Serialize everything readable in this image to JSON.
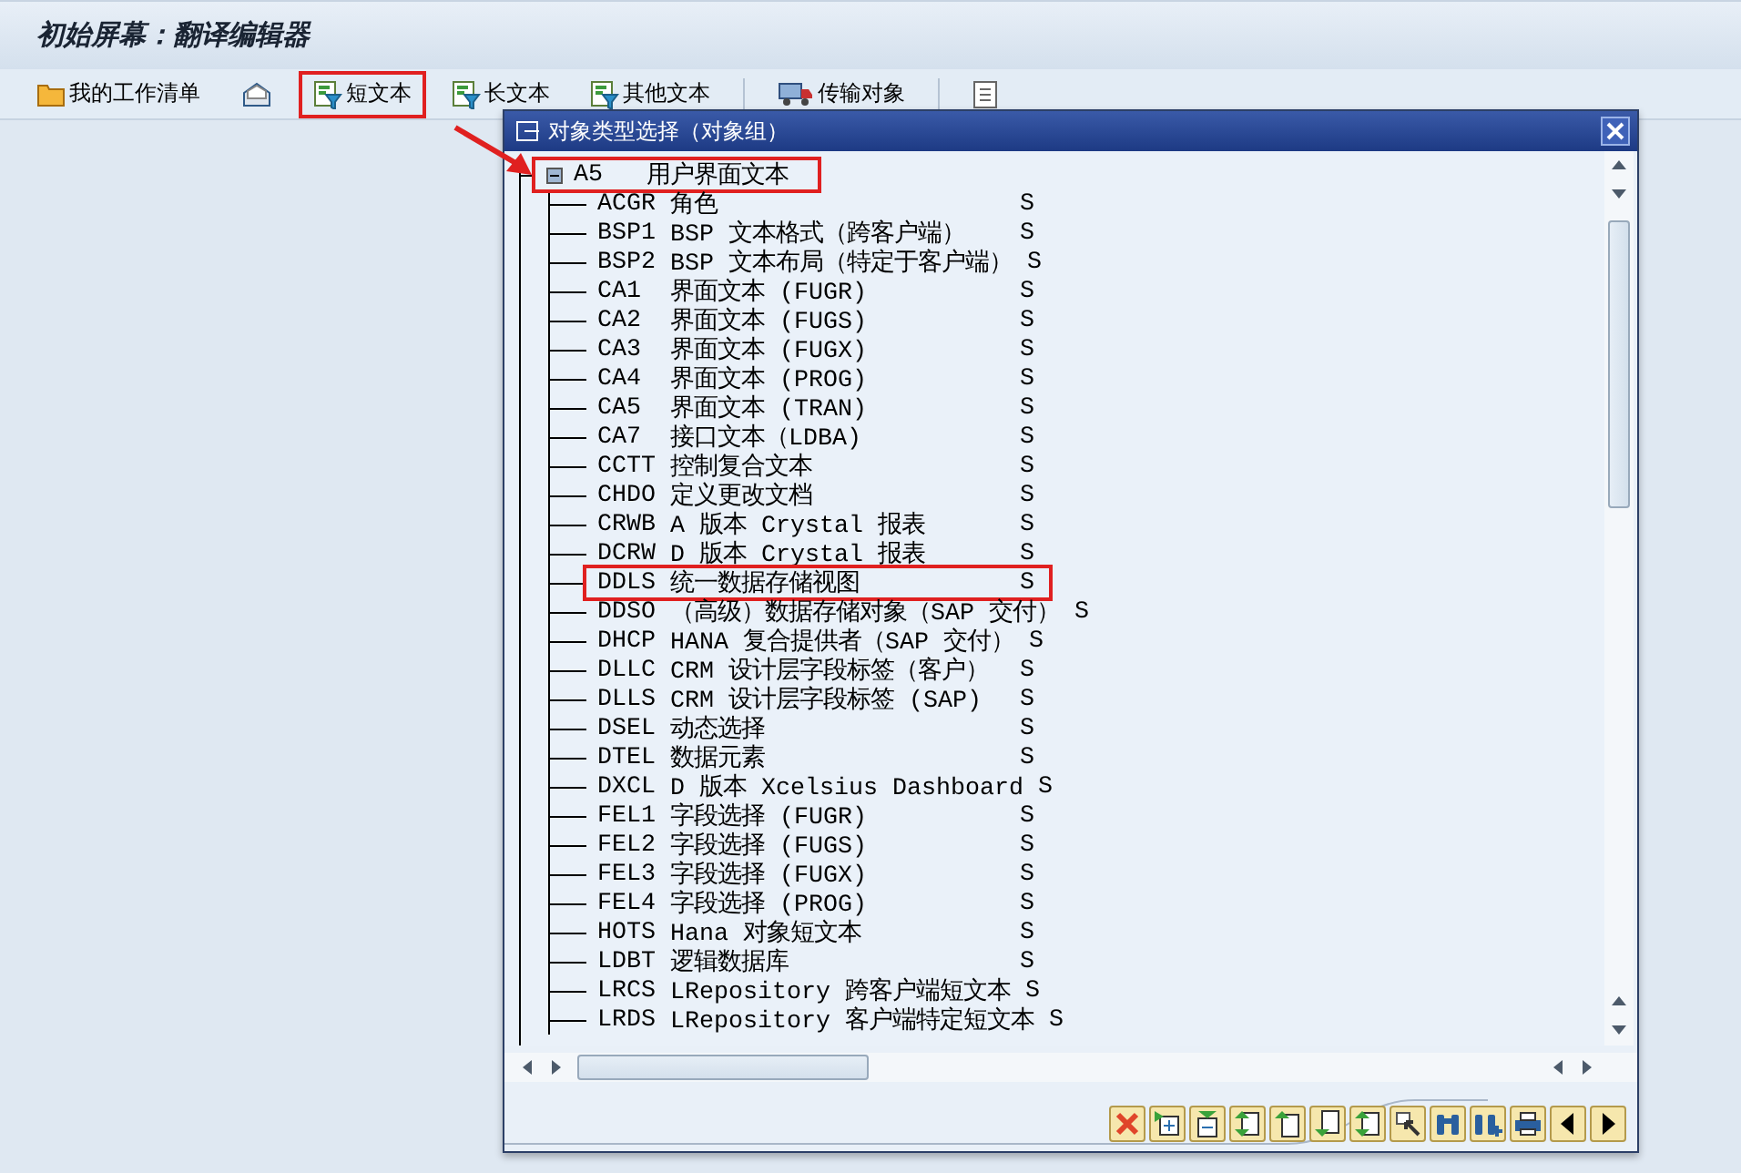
{
  "page": {
    "title": "初始屏幕：翻译编辑器"
  },
  "toolbar": [
    {
      "label": "我的工作清单",
      "highlighted": false
    },
    {
      "highlighted": false
    },
    {
      "label": "短文本",
      "highlighted": true
    },
    {
      "label": "长文本",
      "highlighted": false
    },
    {
      "label": "其他文本",
      "highlighted": false
    },
    {
      "label": "传输对象",
      "highlighted": false
    },
    {
      "highlighted": false
    }
  ],
  "dialog": {
    "title": "对象类型选择（对象组）",
    "tree": {
      "code": "A5",
      "text": "用户界面文本",
      "expanded": true,
      "highlighted": true,
      "children": [
        {
          "code": "ACGR",
          "text": "角色",
          "flag": "S",
          "highlighted": false
        },
        {
          "code": "BSP1",
          "text": "BSP 文本格式（跨客户端）",
          "flag": "S",
          "highlighted": false
        },
        {
          "code": "BSP2",
          "text": "BSP 文本布局（特定于客户端）",
          "flag": "S",
          "highlighted": false
        },
        {
          "code": "CA1",
          "text": "界面文本 (FUGR)",
          "flag": "S",
          "highlighted": false
        },
        {
          "code": "CA2",
          "text": "界面文本 (FUGS)",
          "flag": "S",
          "highlighted": false
        },
        {
          "code": "CA3",
          "text": "界面文本 (FUGX)",
          "flag": "S",
          "highlighted": false
        },
        {
          "code": "CA4",
          "text": "界面文本 (PROG)",
          "flag": "S",
          "highlighted": false
        },
        {
          "code": "CA5",
          "text": "界面文本 (TRAN)",
          "flag": "S",
          "highlighted": false
        },
        {
          "code": "CA7",
          "text": "接口文本（LDBA)",
          "flag": "S",
          "highlighted": false
        },
        {
          "code": "CCTT",
          "text": "控制复合文本",
          "flag": "S",
          "highlighted": false
        },
        {
          "code": "CHDO",
          "text": "定义更改文档",
          "flag": "S",
          "highlighted": false
        },
        {
          "code": "CRWB",
          "text": "A 版本 Crystal 报表",
          "flag": "S",
          "highlighted": false
        },
        {
          "code": "DCRW",
          "text": "D 版本 Crystal 报表",
          "flag": "S",
          "highlighted": false
        },
        {
          "code": "DDLS",
          "text": "统一数据存储视图",
          "flag": "S",
          "highlighted": true
        },
        {
          "code": "DDSO",
          "text": "（高级）数据存储对象（SAP 交付）",
          "flag": "S",
          "highlighted": false
        },
        {
          "code": "DHCP",
          "text": "HANA 复合提供者（SAP 交付）",
          "flag": "S",
          "highlighted": false
        },
        {
          "code": "DLLC",
          "text": "CRM 设计层字段标签（客户）",
          "flag": "S",
          "highlighted": false
        },
        {
          "code": "DLLS",
          "text": "CRM 设计层字段标签 (SAP)",
          "flag": "S",
          "highlighted": false
        },
        {
          "code": "DSEL",
          "text": "动态选择",
          "flag": "S",
          "highlighted": false
        },
        {
          "code": "DTEL",
          "text": "数据元素",
          "flag": "S",
          "highlighted": false
        },
        {
          "code": "DXCL",
          "text": "D 版本 Xcelsius Dashboard",
          "flag": "S",
          "highlighted": false
        },
        {
          "code": "FEL1",
          "text": "字段选择 (FUGR)",
          "flag": "S",
          "highlighted": false
        },
        {
          "code": "FEL2",
          "text": "字段选择 (FUGS)",
          "flag": "S",
          "highlighted": false
        },
        {
          "code": "FEL3",
          "text": "字段选择 (FUGX)",
          "flag": "S",
          "highlighted": false
        },
        {
          "code": "FEL4",
          "text": "字段选择 (PROG)",
          "flag": "S",
          "highlighted": false
        },
        {
          "code": "HOTS",
          "text": "Hana 对象短文本",
          "flag": "S",
          "highlighted": false
        },
        {
          "code": "LDBT",
          "text": "逻辑数据库",
          "flag": "S",
          "highlighted": false
        },
        {
          "code": "LRCS",
          "text": "LRepository 跨客户端短文本",
          "flag": "S",
          "highlighted": false
        },
        {
          "code": "LRDS",
          "text": "LRepository 客户端特定短文本",
          "flag": "S",
          "highlighted": false
        }
      ]
    }
  }
}
